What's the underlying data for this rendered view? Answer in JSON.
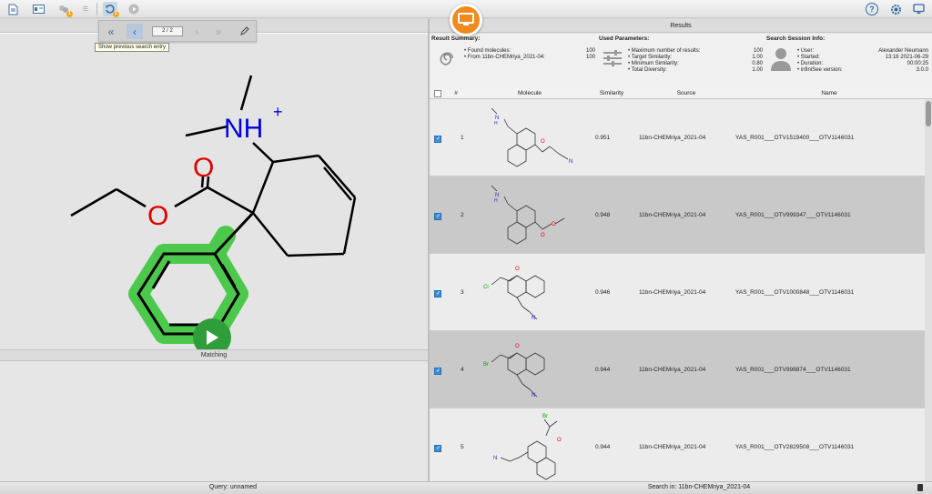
{
  "toolbar": {
    "right_icons": [
      "help-icon",
      "settings-gear-icon",
      "display-icon"
    ]
  },
  "nav": {
    "counter": "2 / 2",
    "tooltip": "Show previous search entry"
  },
  "left": {
    "matching_label": "Matching"
  },
  "results": {
    "header": "Results",
    "summary_title": "Result Summary:",
    "found_label": "Found molecules:",
    "found_value": "100",
    "from_label": "From 11bn-CHEMriya_2021-04:",
    "from_value": "100",
    "params_title": "Used Parameters:",
    "p1_label": "Maximum number of results:",
    "p1_value": "100",
    "p2_label": "Target Similarity:",
    "p2_value": "1.00",
    "p3_label": "Minimum Similarity:",
    "p3_value": "0.80",
    "p4_label": "Total Diversity:",
    "p4_value": "1.00",
    "session_title": "Search Session Info:",
    "s1_label": "User:",
    "s1_value": "Alexander Neumann",
    "s2_label": "Started:",
    "s2_value": "13:16 2021-06-29",
    "s3_label": "Duration:",
    "s3_value": "00:00:25",
    "s4_label": "infiniSee version:",
    "s4_value": "3.0.0"
  },
  "grid": {
    "col_num": "#",
    "col_molecule": "Molecule",
    "col_similarity": "Similarity",
    "col_source": "Source",
    "col_name": "Name",
    "rows": [
      {
        "num": "1",
        "similarity": "0.951",
        "source": "11bn-CHEMriya_2021-04",
        "name": "YAS_R001___OTV1519400___OTV1146031",
        "checked": true
      },
      {
        "num": "2",
        "similarity": "0.948",
        "source": "11bn-CHEMriya_2021-04",
        "name": "YAS_R001___OTV999347___OTV1146031",
        "checked": true
      },
      {
        "num": "3",
        "similarity": "0.946",
        "source": "11bn-CHEMriya_2021-04",
        "name": "YAS_R001___OTV1000848___OTV1146031",
        "checked": true
      },
      {
        "num": "4",
        "similarity": "0.944",
        "source": "11bn-CHEMriya_2021-04",
        "name": "YAS_R001___OTV998874___OTV1146031",
        "checked": true
      },
      {
        "num": "5",
        "similarity": "0.944",
        "source": "11bn-CHEMriya_2021-04",
        "name": "YAS_R001___OTV2829508___OTV1146031",
        "checked": true
      }
    ]
  },
  "status": {
    "query": "Query: unnamed",
    "search_in": "Search in: 11bn-CHEMriya_2021-04"
  },
  "colors": {
    "accent": "#f18a1c",
    "highlight": "#4cc94c",
    "play": "#2f9e3a",
    "checkbox": "#3d8ed6"
  }
}
